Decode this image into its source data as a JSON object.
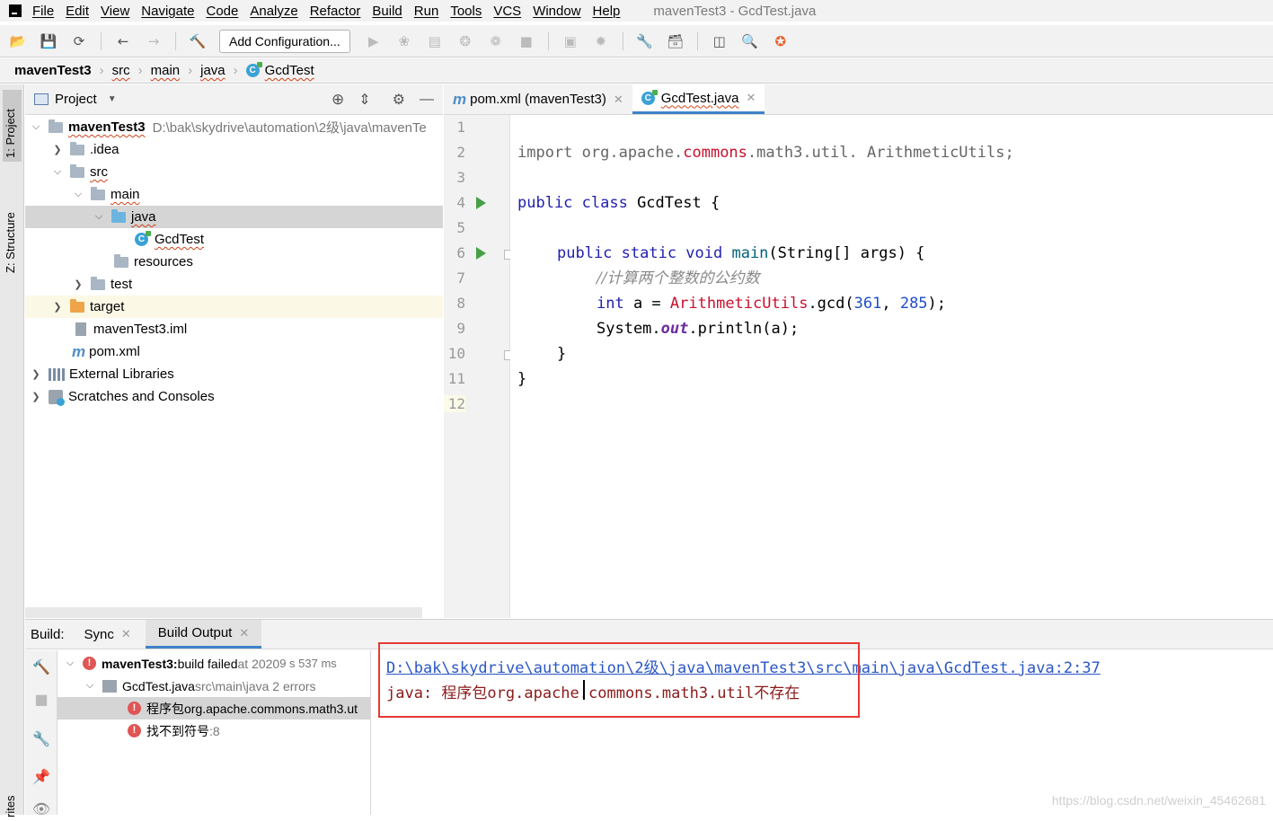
{
  "window": {
    "title": "mavenTest3 - GcdTest.java"
  },
  "menu": [
    "File",
    "Edit",
    "View",
    "Navigate",
    "Code",
    "Analyze",
    "Refactor",
    "Build",
    "Run",
    "Tools",
    "VCS",
    "Window",
    "Help"
  ],
  "toolbar": {
    "add_config_label": "Add Configuration..."
  },
  "breadcrumb": [
    "mavenTest3",
    "src",
    "main",
    "java",
    "GcdTest"
  ],
  "sidebar_tabs": {
    "project": "1: Project",
    "structure": "Z: Structure",
    "favorites": "rites"
  },
  "project_panel": {
    "title": "Project",
    "root_name": "mavenTest3",
    "root_path": "D:\\bak\\skydrive\\automation\\2级\\java\\mavenTe",
    "items": [
      ".idea",
      "src",
      "main",
      "java",
      "GcdTest",
      "resources",
      "test",
      "target",
      "mavenTest3.iml",
      "pom.xml",
      "External Libraries",
      "Scratches and Consoles"
    ]
  },
  "editor": {
    "tabs": [
      "pom.xml (mavenTest3)",
      "GcdTest.java"
    ],
    "active_tab": "GcdTest.java",
    "line_numbers": [
      "1",
      "2",
      "3",
      "4",
      "5",
      "6",
      "7",
      "8",
      "9",
      "10",
      "11",
      "12"
    ],
    "code": {
      "l2_import": "import",
      "l2_pkg1": " org.apache.",
      "l2_pkg2": "commons",
      "l2_pkg3": ".math3.util. ArithmeticUtils;",
      "l4_kw": "public class",
      "l4_rest": " GcdTest {",
      "l6_kw": "public static void",
      "l6_name": " main",
      "l6_rest": "(String[] args) {",
      "l7_comment": "//计算两个整数的公约数",
      "l8_kw": "int",
      "l8_a": " a = ",
      "l8_cls": "ArithmeticUtils",
      "l8_call": ".gcd(",
      "l8_n1": "361",
      "l8_sep": ", ",
      "l8_n2": "285",
      "l8_end": ");",
      "l9_sys": "System.",
      "l9_out": "out",
      "l9_rest": ".println(a);",
      "l10": "}",
      "l11": "}"
    }
  },
  "build_panel": {
    "label": "Build:",
    "tabs": [
      "Sync",
      "Build Output"
    ],
    "active_tab": "Build Output",
    "tree": {
      "root_project": "mavenTest3:",
      "root_status": " build failed",
      "root_time": " at 2020",
      "root_duration": " 9 s 537 ms",
      "file_name": "GcdTest.java",
      "file_info": " src\\main\\java 2 errors",
      "error1": "程序包org.apache.commons.math3.ut",
      "error2": "找不到符号",
      "error2_line": " :8"
    },
    "console": {
      "link": "D:\\bak\\skydrive\\automation\\2级\\java\\mavenTest3\\src\\main\\java\\GcdTest.java:2:37",
      "msg_prefix": "java: ",
      "msg_cn1": "程序包",
      "msg_mono": "org.apache.commons.math3.util",
      "msg_cn2": "不存在"
    }
  },
  "watermark": "https://blog.csdn.net/weixin_45462681",
  "colors": {
    "accent": "#4083c9",
    "error": "#e53935",
    "keyword": "#1f1fb0",
    "run": "#45a047"
  }
}
